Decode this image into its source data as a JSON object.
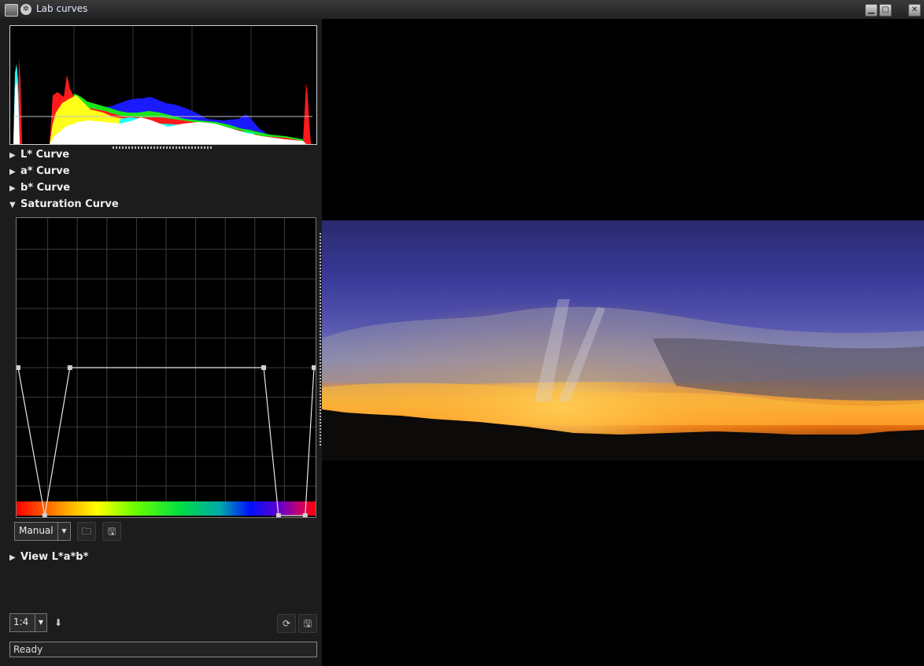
{
  "window": {
    "title": "Lab curves",
    "icon": "app-icon",
    "controls": [
      "minimize-icon",
      "maximize-icon",
      "close-icon"
    ]
  },
  "curves_panel": {
    "sections": [
      {
        "label": "L* Curve",
        "expanded": false
      },
      {
        "label": "a* Curve",
        "expanded": false
      },
      {
        "label": "b* Curve",
        "expanded": false
      },
      {
        "label": "Saturation Curve",
        "expanded": true
      },
      {
        "label": "View L*a*b*",
        "expanded": false
      }
    ],
    "preset_value": "Manual",
    "preset_buttons": [
      "folder-open-icon",
      "save-icon"
    ]
  },
  "saturation_curve": {
    "points": [
      {
        "hue": 0.0,
        "level": 0.5
      },
      {
        "hue": 0.09,
        "level": 0.0
      },
      {
        "hue": 0.175,
        "level": 0.5
      },
      {
        "hue": 0.83,
        "level": 0.5
      },
      {
        "hue": 0.88,
        "level": 0.0
      },
      {
        "hue": 0.97,
        "level": 0.0
      },
      {
        "hue": 1.0,
        "level": 0.5
      }
    ]
  },
  "bottom_bar": {
    "zoom_value": "1:4",
    "buttons": [
      "download-arrow-icon",
      "refresh-icon",
      "save-icon"
    ],
    "status": "Ready"
  },
  "colors": {
    "background": "#1c1c1c",
    "histogram_red": "#ff1a1a",
    "histogram_green": "#19e619",
    "histogram_blue": "#1a1aff",
    "histogram_yellow": "#ffff1a",
    "histogram_cyan": "#19ffff"
  }
}
